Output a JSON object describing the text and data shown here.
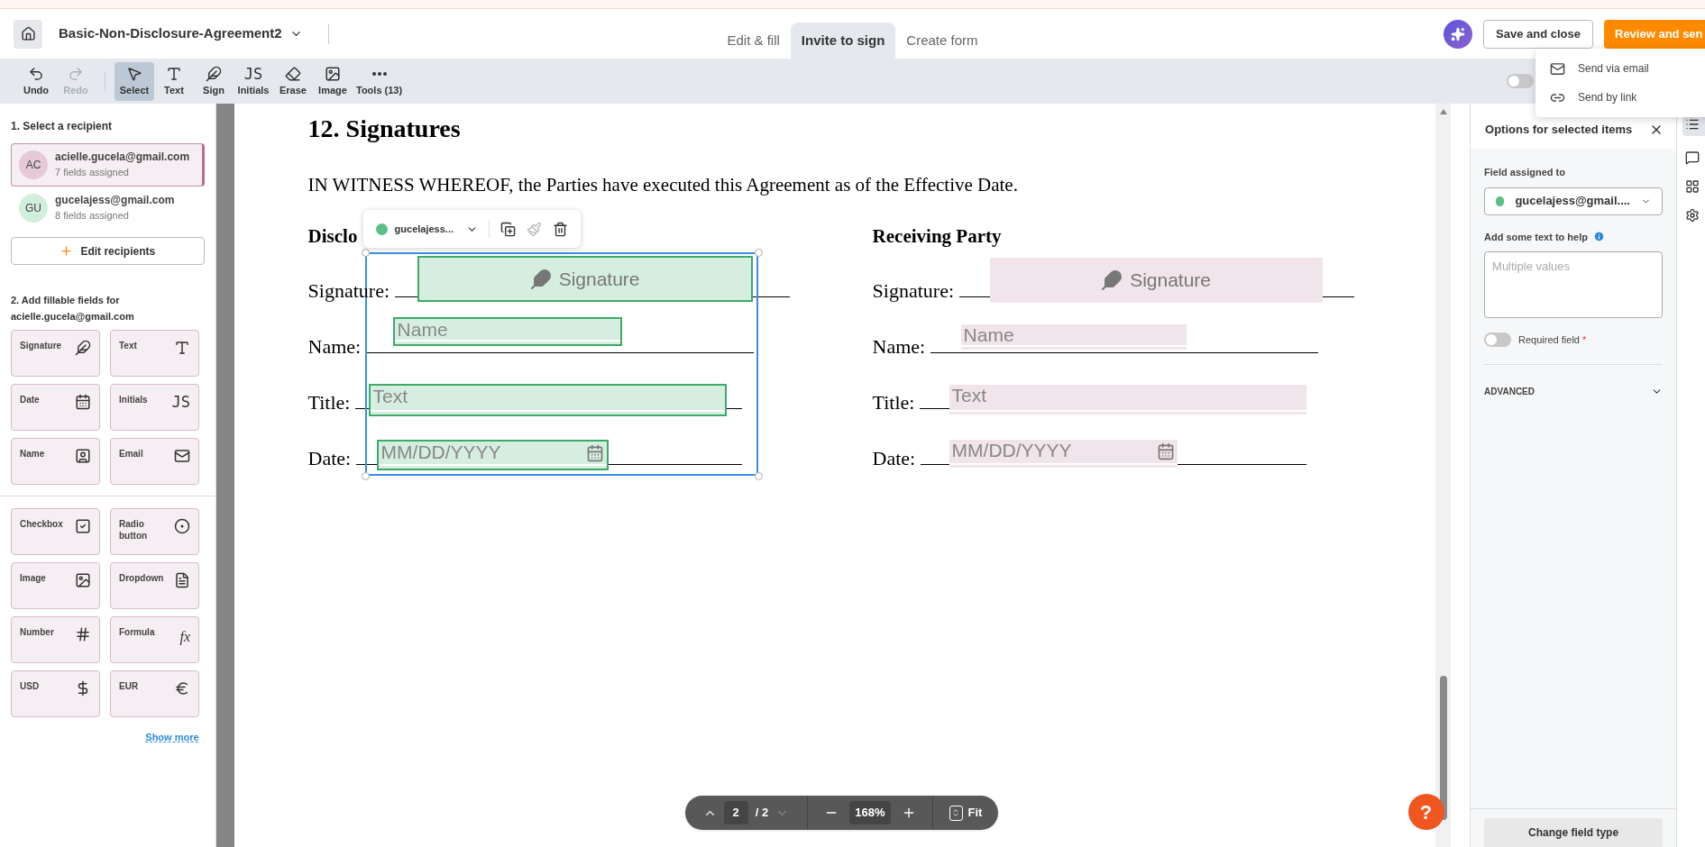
{
  "header": {
    "title": "Basic-Non-Disclosure-Agreement2",
    "tabs": [
      {
        "label": "Edit & fill",
        "selected": false
      },
      {
        "label": "Invite to sign",
        "selected": true
      },
      {
        "label": "Create form",
        "selected": false
      }
    ],
    "save_button": "Save and close",
    "review_button": "Review and sen"
  },
  "send_menu": [
    {
      "kind": "email",
      "label": "Send via email"
    },
    {
      "kind": "link",
      "label": "Send by link"
    }
  ],
  "toolbar": {
    "items": [
      {
        "kind": "undo",
        "label": "Undo",
        "selected": false,
        "disabled": false
      },
      {
        "kind": "redo",
        "label": "Redo",
        "selected": false,
        "disabled": true
      },
      {
        "kind": "select",
        "label": "Select",
        "selected": true,
        "disabled": false
      },
      {
        "kind": "text",
        "label": "Text",
        "selected": false,
        "disabled": false
      },
      {
        "kind": "sign",
        "label": "Sign",
        "selected": false,
        "disabled": false
      },
      {
        "kind": "initials",
        "label": "Initials",
        "glyph": "JS",
        "selected": false,
        "disabled": false
      },
      {
        "kind": "erase",
        "label": "Erase",
        "selected": false,
        "disabled": false
      },
      {
        "kind": "image",
        "label": "Image",
        "selected": false,
        "disabled": false
      },
      {
        "kind": "more",
        "label": "Tools (13)",
        "selected": false,
        "disabled": false
      }
    ],
    "toggle_on": false
  },
  "sidebar": {
    "step1": "1. Select a recipient",
    "recipients": [
      {
        "initials": "AC",
        "email": "acielle.gucela@gmail.com",
        "count": "7 fields assigned",
        "selected": true,
        "color": "#e6c9d8"
      },
      {
        "initials": "GU",
        "email": "gucelajess@gmail.com",
        "count": "8 fields assigned",
        "selected": false,
        "color": "#d2eedd"
      }
    ],
    "edit_recipients": "Edit recipients",
    "step2": "2. Add fillable fields for",
    "step2_email": "acielle.gucela@gmail.com",
    "field_groups": [
      [
        {
          "kind": "signature",
          "label": "Signature"
        },
        {
          "kind": "text",
          "label": "Text"
        },
        {
          "kind": "date",
          "label": "Date"
        },
        {
          "kind": "initials",
          "label": "Initials",
          "glyph": "JS"
        },
        {
          "kind": "name",
          "label": "Name"
        },
        {
          "kind": "email",
          "label": "Email"
        }
      ],
      [
        {
          "kind": "checkbox",
          "label": "Checkbox"
        },
        {
          "kind": "radio",
          "label": "Radio button"
        },
        {
          "kind": "image",
          "label": "Image"
        },
        {
          "kind": "dropdown",
          "label": "Dropdown"
        },
        {
          "kind": "number",
          "label": "Number"
        },
        {
          "kind": "formula",
          "label": "Formula",
          "glyph": "fx"
        },
        {
          "kind": "usd",
          "label": "USD"
        },
        {
          "kind": "eur",
          "label": "EUR"
        }
      ]
    ],
    "show_more": "Show more"
  },
  "document": {
    "heading": "12. Signatures",
    "paragraph": "IN WITNESS WHEREOF, the Parties have executed this Agreement as of the Effective Date.",
    "columns": [
      {
        "heading": "Disclo",
        "selected": true,
        "color": "#d6eee0",
        "rows": [
          {
            "kind": "signature",
            "label": "Signature:",
            "field": "Signature"
          },
          {
            "kind": "name",
            "label": "Name:",
            "field": "Name"
          },
          {
            "kind": "text",
            "label": "Title:",
            "field": "Text"
          },
          {
            "kind": "date",
            "label": "Date:",
            "field": "MM/DD/YYYY"
          }
        ]
      },
      {
        "heading": "Receiving Party",
        "selected": false,
        "color": "#f1e4ea",
        "rows": [
          {
            "kind": "signature",
            "label": "Signature:",
            "field": "Signature"
          },
          {
            "kind": "name",
            "label": "Name:",
            "field": "Name"
          },
          {
            "kind": "text",
            "label": "Title:",
            "field": "Text"
          },
          {
            "kind": "date",
            "label": "Date:",
            "field": "MM/DD/YYYY"
          }
        ]
      }
    ],
    "field_toolbar": {
      "recipient": "gucelajess...",
      "color": "#5cbf8a"
    }
  },
  "pager": {
    "page": "2",
    "total": "/ 2",
    "zoom": "168%",
    "fit": "Fit"
  },
  "help": "?",
  "right_panel": {
    "title": "Options for selected items",
    "assigned_label": "Field assigned to",
    "assigned": {
      "value": "gucelajess@gmail....",
      "color": "#5cbf8a"
    },
    "help_label": "Add some text to help",
    "help_placeholder": "Multiple values",
    "required_label": "Required field",
    "required_mark": "*",
    "required_on": false,
    "advanced": "ADVANCED",
    "change_type": "Change field type"
  }
}
